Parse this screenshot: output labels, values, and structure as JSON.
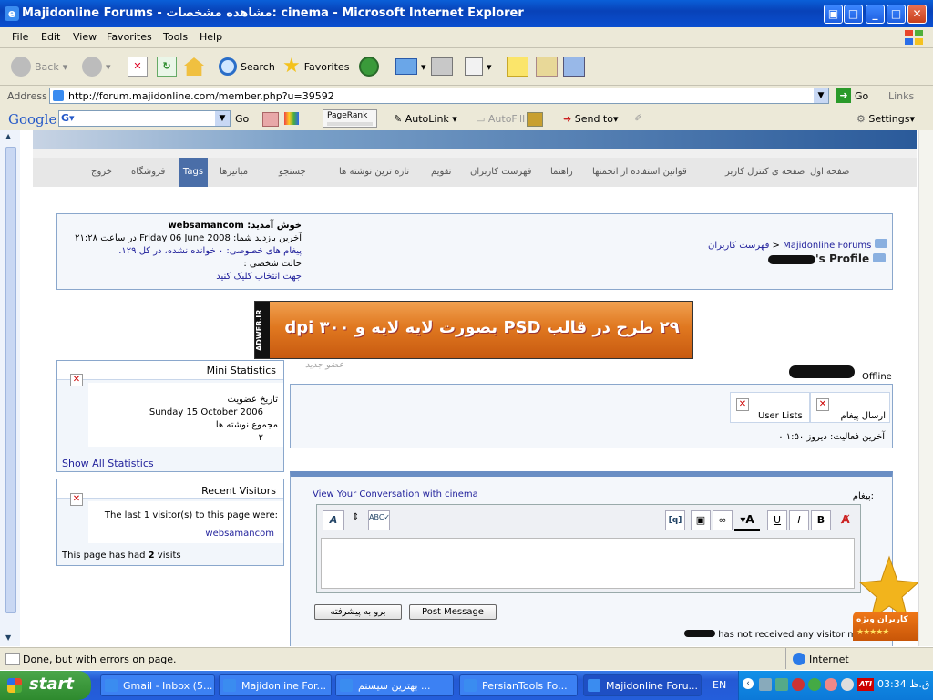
{
  "window": {
    "title": "Majidonline Forums - مشاهده مشخصات: cinema - Microsoft Internet Explorer"
  },
  "menu": [
    "File",
    "Edit",
    "View",
    "Favorites",
    "Tools",
    "Help"
  ],
  "toolbar": {
    "back": "Back",
    "search": "Search",
    "favorites": "Favorites"
  },
  "address": {
    "label": "Address",
    "url": "http://forum.majidonline.com/member.php?u=39592",
    "go": "Go",
    "links": "Links"
  },
  "google": {
    "logo": "Google",
    "go": "Go",
    "pagerank": "PageRank",
    "autolink": "AutoLink",
    "autofill": "AutoFill",
    "sendto": "Send to",
    "settings": "Settings"
  },
  "forum": {
    "nav": [
      "صفحه اول",
      "صفحه ی کنترل کاربر",
      "قوانین استفاده از انجمنها",
      "راهنما",
      "فهرست کاربران",
      "تقویم",
      "تازه ترین نوشته ها",
      "جستجو",
      "مبانیرها",
      "Tags",
      "فروشگاه",
      "خروج"
    ],
    "welcome": {
      "line1": "خوش آمدید: websamancom",
      "line2": "آخرین بازدید شما: Friday 06 June 2008 در ساعت ۲۱:۲۸",
      "line3": "پیغام های خصوصی: ۰ خوانده نشده، در کل ۱۲۹.",
      "line4": "حالت شخصی :",
      "line5": "جهت انتخاب کلیک کنید"
    },
    "breadcrumb": {
      "site": "Majidonline Forums",
      "sep": ">",
      "members": "فهرست کاربران",
      "profile": "'s Profile"
    },
    "banner": {
      "text": "۲۹ طرح در قالب PSD بصورت لایه لایه و ۳۰۰ dpi",
      "side": "ADWEB.IR",
      "sub": "عضو جدید"
    },
    "mini_stats": {
      "title": "Mini Statistics",
      "join_label": "تاریخ عضویت",
      "join_date": "Sunday 15 October 2006",
      "posts_label": "مجموع نوشته ها",
      "posts": "۲",
      "show_all": "Show All Statistics"
    },
    "visitors": {
      "title": "Recent Visitors",
      "text": "The last 1 visitor(s) to this page were:",
      "visitor": "websamancom",
      "visits_pre": "This page has had",
      "visits": "2",
      "visits_post": "visits"
    },
    "status": {
      "offline": "Offline",
      "send_message": "ارسال پیغام",
      "user_lists": "User Lists",
      "last_activity": "آخرین فعالیت: دیروز ۱:۵۰ ۰"
    },
    "message": {
      "label": "پیغام:",
      "conversation": "View Your Conversation with cinema",
      "post": "Post Message",
      "advanced": "برو به پیشرفته",
      "no_visitor": "has not received any visitor m"
    },
    "badge": "کاربران ویژه"
  },
  "statusbar": {
    "text": "Done, but with errors on page.",
    "zone": "Internet"
  },
  "taskbar": {
    "start": "start",
    "tasks": [
      "Gmail - Inbox (5...",
      "Majidonline For...",
      "بهترین سیستم ...",
      "PersianTools Fo...",
      "Majidonline Foru..."
    ],
    "lang": "EN",
    "clock": "03:34 ق.ظ"
  }
}
